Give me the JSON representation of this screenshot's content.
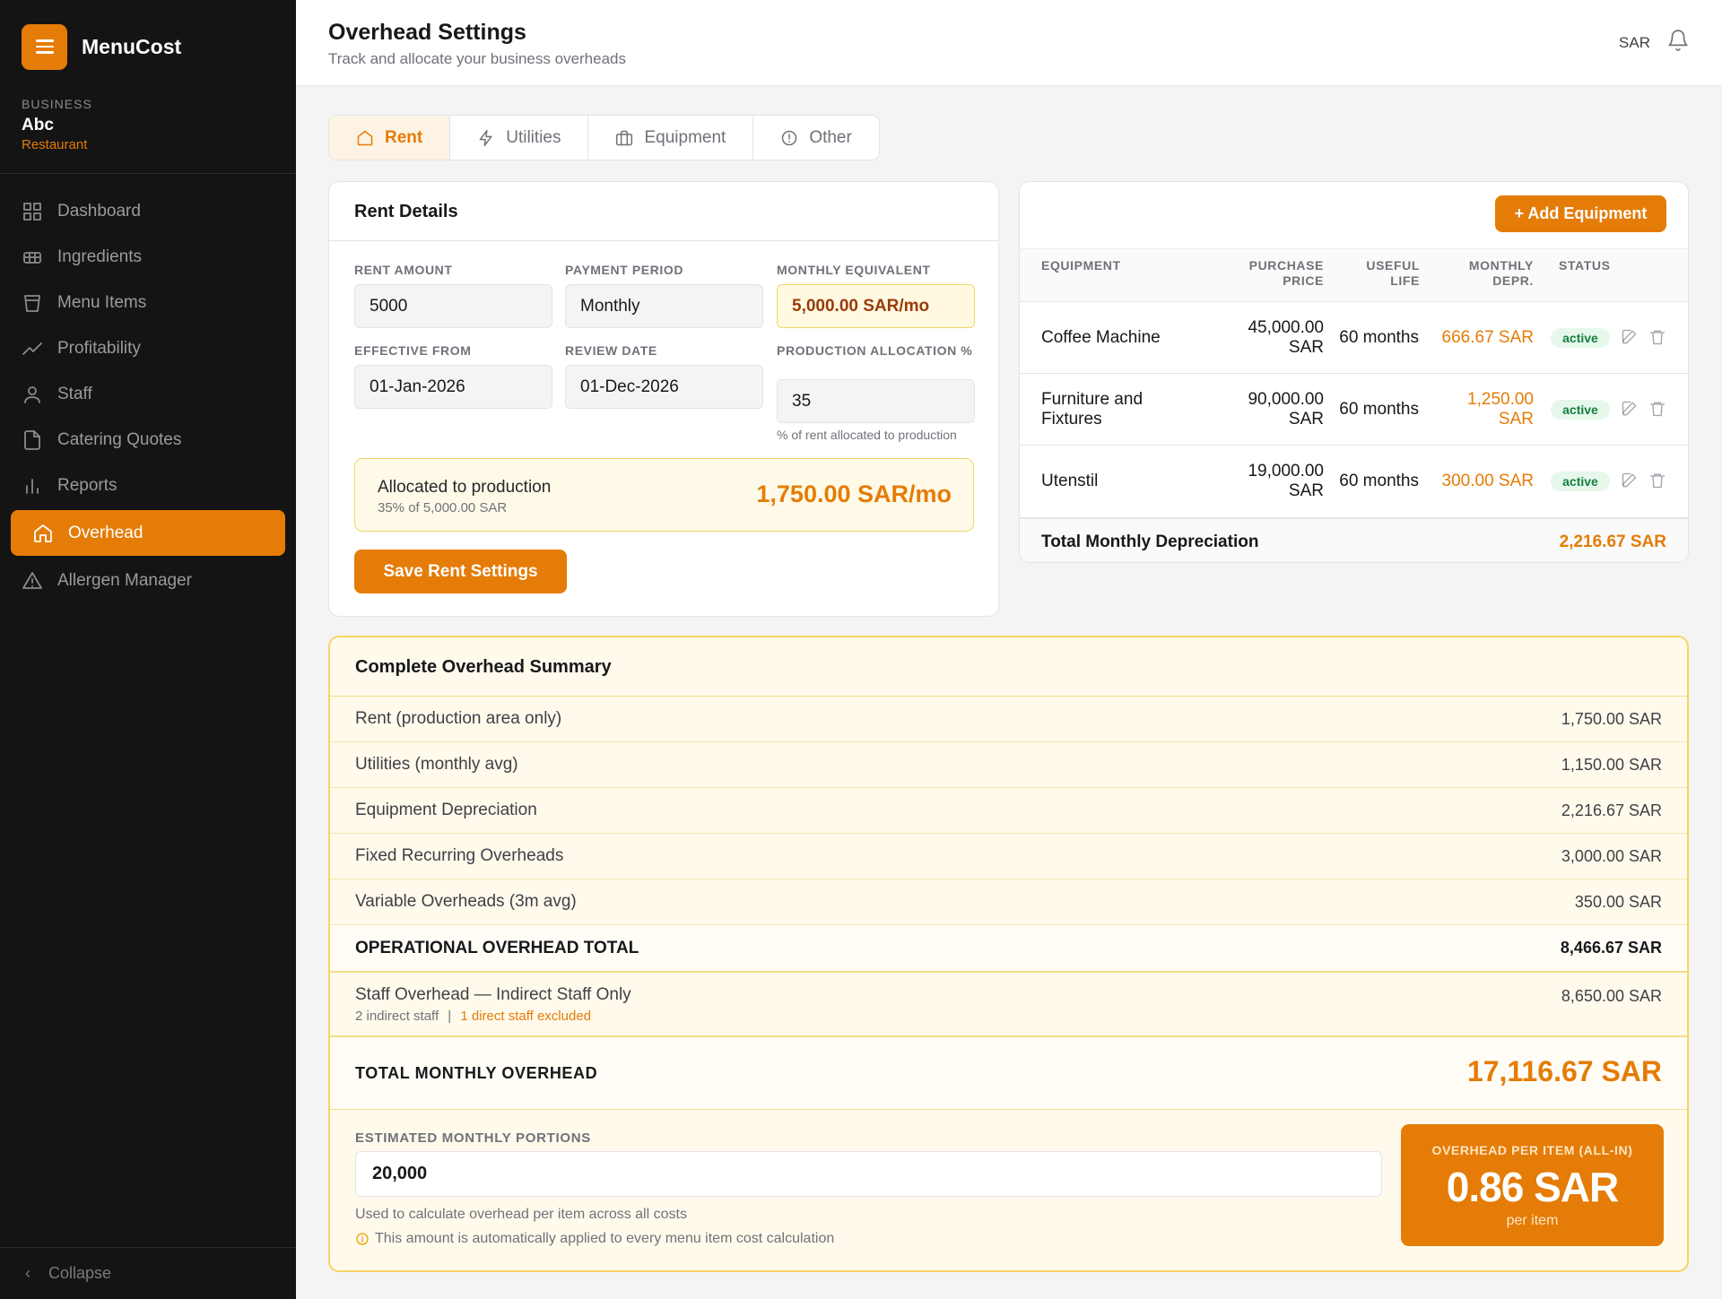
{
  "app": {
    "name": "MenuCost"
  },
  "business": {
    "label": "BUSINESS",
    "name": "Abc",
    "type": "Restaurant"
  },
  "nav": {
    "items": [
      {
        "label": "Dashboard",
        "icon": "grid-icon"
      },
      {
        "label": "Ingredients",
        "icon": "ingredients-icon"
      },
      {
        "label": "Menu Items",
        "icon": "cup-icon"
      },
      {
        "label": "Profitability",
        "icon": "trend-icon"
      },
      {
        "label": "Staff",
        "icon": "user-icon"
      },
      {
        "label": "Catering Quotes",
        "icon": "file-icon"
      },
      {
        "label": "Reports",
        "icon": "bar-chart-icon"
      },
      {
        "label": "Overhead",
        "icon": "home-icon",
        "active": true
      },
      {
        "label": "Allergen Manager",
        "icon": "warning-icon"
      }
    ],
    "collapse": "Collapse"
  },
  "header": {
    "title": "Overhead Settings",
    "subtitle": "Track and allocate your business overheads",
    "currency": "SAR"
  },
  "tabs": [
    {
      "label": "Rent",
      "icon": "home-icon",
      "active": true
    },
    {
      "label": "Utilities",
      "icon": "bolt-icon"
    },
    {
      "label": "Equipment",
      "icon": "briefcase-icon"
    },
    {
      "label": "Other",
      "icon": "info-icon"
    }
  ],
  "rent": {
    "title": "Rent Details",
    "amount_label": "RENT AMOUNT",
    "amount": "5000",
    "period_label": "PAYMENT PERIOD",
    "period": "Monthly",
    "monthly_label": "MONTHLY EQUIVALENT",
    "monthly": "5,000.00 SAR/mo",
    "from_label": "EFFECTIVE FROM",
    "from": "01-Jan-2026",
    "review_label": "REVIEW DATE",
    "review": "01-Dec-2026",
    "alloc_label": "PRODUCTION ALLOCATION %",
    "alloc_value": "35",
    "alloc_hint": "% of rent allocated to production",
    "allocated_title": "Allocated to production",
    "allocated_sub": "35% of 5,000.00 SAR",
    "allocated_value": "1,750.00 SAR/mo",
    "save_label": "Save Rent Settings"
  },
  "equipment": {
    "add_label": "+ Add Equipment",
    "headers": {
      "name": "EQUIPMENT",
      "price_1": "PURCHASE",
      "price_2": "PRICE",
      "life_1": "USEFUL",
      "life_2": "LIFE",
      "depr_1": "MONTHLY",
      "depr_2": "DEPR.",
      "status": "STATUS"
    },
    "rows": [
      {
        "name_1": "Coffee Machine",
        "name_2": "",
        "price_1": "45,000.00",
        "price_2": "SAR",
        "life": "60 months",
        "depr_1": "666.67 SAR",
        "depr_2": "",
        "status": "active"
      },
      {
        "name_1": "Furniture and",
        "name_2": "Fixtures",
        "price_1": "90,000.00",
        "price_2": "SAR",
        "life": "60 months",
        "depr_1": "1,250.00",
        "depr_2": "SAR",
        "status": "active"
      },
      {
        "name_1": "Utenstil",
        "name_2": "",
        "price_1": "19,000.00",
        "price_2": "SAR",
        "life": "60 months",
        "depr_1": "300.00 SAR",
        "depr_2": "",
        "status": "active"
      }
    ],
    "total_label": "Total Monthly Depreciation",
    "total_value": "2,216.67 SAR"
  },
  "summary": {
    "title": "Complete Overhead Summary",
    "rows": [
      {
        "label": "Rent (production area only)",
        "value": "1,750.00 SAR"
      },
      {
        "label": "Utilities (monthly avg)",
        "value": "1,150.00 SAR"
      },
      {
        "label": "Equipment Depreciation",
        "value": "2,216.67 SAR"
      },
      {
        "label": "Fixed Recurring Overheads",
        "value": "3,000.00 SAR"
      },
      {
        "label": "Variable Overheads (3m avg)",
        "value": "350.00 SAR"
      }
    ],
    "operational_label": "OPERATIONAL OVERHEAD TOTAL",
    "operational_value": "8,466.67 SAR",
    "staff_label": "Staff Overhead — Indirect Staff Only",
    "staff_indirect": "2 indirect staff",
    "staff_sep": "|",
    "staff_excluded": "1 direct staff excluded",
    "staff_value": "8,650.00 SAR",
    "total_label": "TOTAL MONTHLY OVERHEAD",
    "total_value": "17,116.67 SAR",
    "portions_label": "ESTIMATED MONTHLY PORTIONS",
    "portions_value": "20,000",
    "portions_hint": "Used to calculate overhead per item across all costs",
    "portions_note": "This amount is automatically applied to every menu item cost calculation",
    "per_item_label": "OVERHEAD PER ITEM (ALL-IN)",
    "per_item_value": "0.86 SAR",
    "per_item_sub": "per item"
  },
  "colors": {
    "accent": "#e57c07",
    "sidebar": "#141414",
    "success": "#15803d"
  }
}
